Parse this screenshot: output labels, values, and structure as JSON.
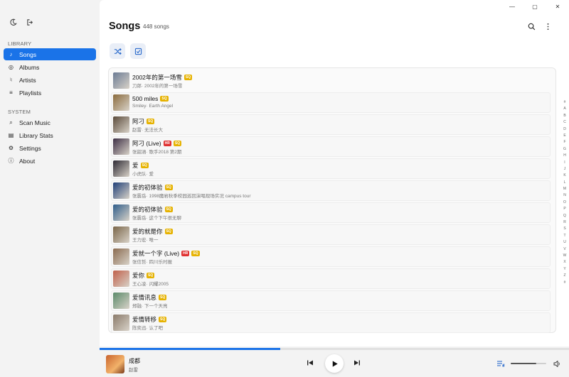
{
  "window": {
    "minimize": "—",
    "maximize": "▢",
    "close": "✕"
  },
  "sidebar": {
    "library_label": "LIBRARY",
    "system_label": "SYSTEM",
    "library_items": [
      {
        "label": "Songs",
        "icon": "music-note-icon",
        "active": true
      },
      {
        "label": "Albums",
        "icon": "disc-icon"
      },
      {
        "label": "Artists",
        "icon": "microphone-icon"
      },
      {
        "label": "Playlists",
        "icon": "playlist-icon"
      }
    ],
    "system_items": [
      {
        "label": "Scan Music",
        "icon": "scan-icon"
      },
      {
        "label": "Library Stats",
        "icon": "stats-icon"
      },
      {
        "label": "Settings",
        "icon": "gear-icon"
      },
      {
        "label": "About",
        "icon": "info-icon"
      }
    ]
  },
  "header": {
    "title": "Songs",
    "count": "448 songs"
  },
  "songs": [
    {
      "title": "2002年的第一场雪",
      "sub": "刀郎· 2002年的第一场雪",
      "badges": [
        "SQ"
      ],
      "color": "#6b7b94"
    },
    {
      "title": "500 miles",
      "sub": "Smiley· Earth Angel",
      "badges": [
        "SQ"
      ],
      "color": "#8a6a3c"
    },
    {
      "title": "阿刁",
      "sub": "赵雷· 无法长大",
      "badges": [
        "SQ"
      ],
      "color": "#5a4a3a"
    },
    {
      "title": "阿刁 (Live)",
      "sub": "张韶涵· 歌手2018 第2期",
      "badges": [
        "HR",
        "SQ"
      ],
      "color": "#3d2f45"
    },
    {
      "title": "爱",
      "sub": "小虎队· 爱",
      "badges": [
        "SQ"
      ],
      "color": "#2e2a34"
    },
    {
      "title": "爱的初体验",
      "sub": "张震岳· 1998魔岩秋季校园巡回演唱现场实况 campus tour",
      "badges": [
        "SQ"
      ],
      "color": "#1f3f78"
    },
    {
      "title": "爱的初体验",
      "sub": "张震岳· 这个下午很无聊",
      "badges": [
        "SQ"
      ],
      "color": "#2e5c8a"
    },
    {
      "title": "爱的就是你",
      "sub": "王力宏· 唯一",
      "badges": [
        "SQ"
      ],
      "color": "#7a6548"
    },
    {
      "title": "爱就一个字 (Live)",
      "sub": "张信哲· 四川乐时报",
      "badges": [
        "HR",
        "SQ"
      ],
      "color": "#8a6a4f"
    },
    {
      "title": "爱你",
      "sub": "王心凌· 闪耀2005",
      "badges": [
        "SQ"
      ],
      "color": "#c0604a"
    },
    {
      "title": "爱情讯息",
      "sub": "郑融· 下一个天亮",
      "badges": [
        "SQ"
      ],
      "color": "#5a8a6a"
    },
    {
      "title": "爱情转移",
      "sub": "陈奕迅· 认了吧",
      "badges": [
        "SQ"
      ],
      "color": "#8a7a6a"
    }
  ],
  "alphabet": [
    "#",
    "A",
    "B",
    "C",
    "D",
    "E",
    "F",
    "G",
    "H",
    "I",
    "J",
    "K",
    "L",
    "M",
    "N",
    "O",
    "P",
    "Q",
    "R",
    "S",
    "T",
    "U",
    "V",
    "W",
    "X",
    "Y",
    "Z",
    "#"
  ],
  "player": {
    "title": "成都",
    "artist": "赵雷",
    "progress": 0.385,
    "volume": 0.72
  }
}
